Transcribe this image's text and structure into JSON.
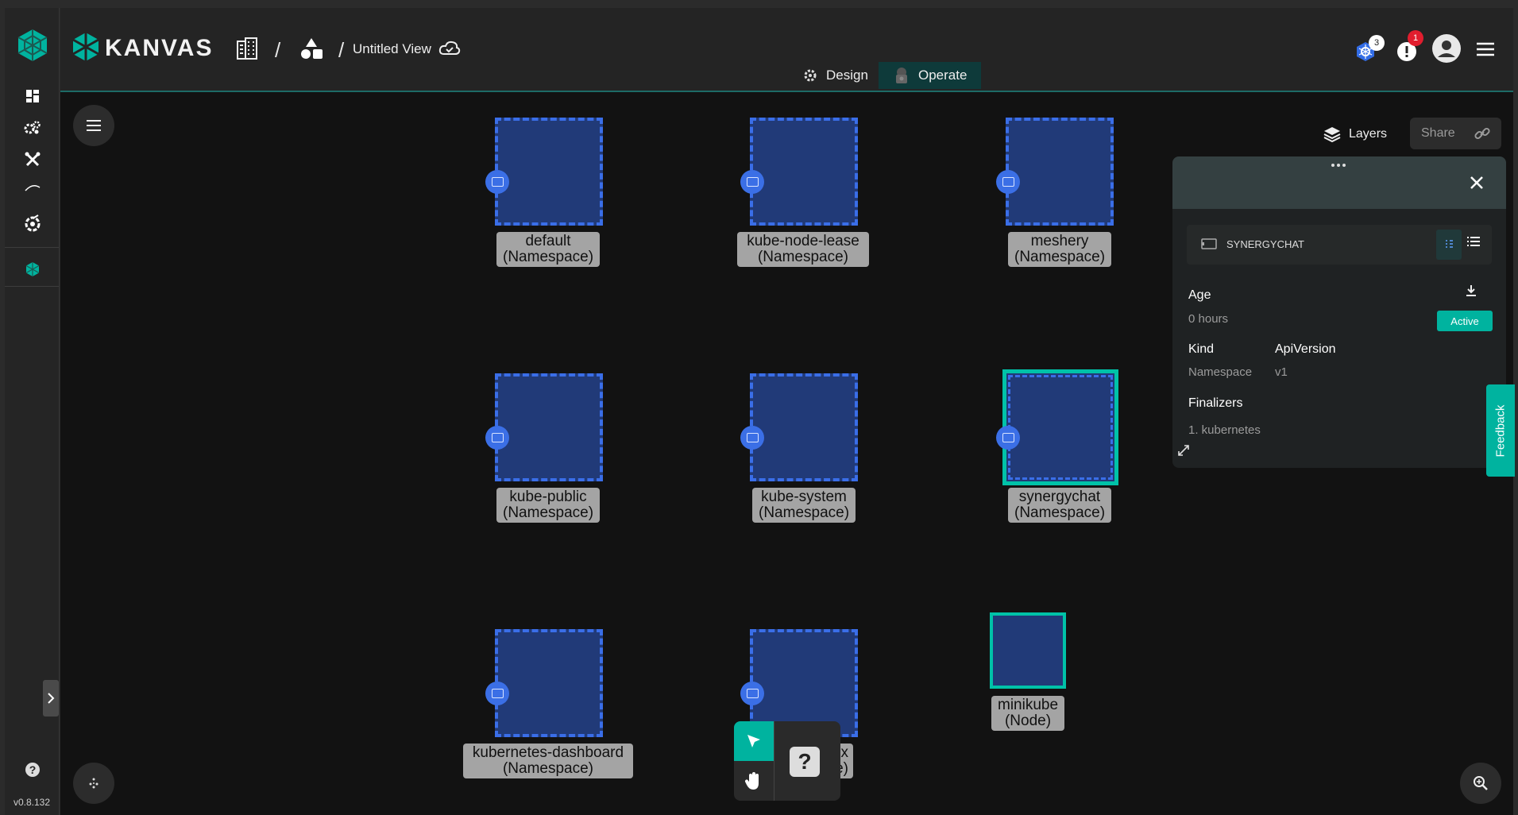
{
  "app": {
    "brand": "KANVAS",
    "view_title": "Untitled View",
    "version": "v0.8.132"
  },
  "header": {
    "modes": [
      {
        "label": "Design",
        "active": false
      },
      {
        "label": "Operate",
        "active": true
      }
    ],
    "kube_badge_count": "3",
    "notification_count": "1"
  },
  "toolbar": {
    "layers_label": "Layers",
    "share_label": "Share"
  },
  "nodes": [
    {
      "name": "default",
      "kind": "(Namespace)"
    },
    {
      "name": "kube-node-lease",
      "kind": "(Namespace)"
    },
    {
      "name": "meshery",
      "kind": "(Namespace)"
    },
    {
      "name": "kube-public",
      "kind": "(Namespace)"
    },
    {
      "name": "kube-system",
      "kind": "(Namespace)"
    },
    {
      "name": "synergychat",
      "kind": "(Namespace)"
    },
    {
      "name": "kubernetes-dashboard",
      "kind": "(Namespace)"
    },
    {
      "name": "nx",
      "kind": "e)"
    },
    {
      "name": "minikube",
      "kind": "(Node)"
    }
  ],
  "panel": {
    "resource_name": "SYNERGYCHAT",
    "age_label": "Age",
    "age_value": "0 hours",
    "status": "Active",
    "kind_label": "Kind",
    "kind_value": "Namespace",
    "api_label": "ApiVersion",
    "api_value": "v1",
    "finalizers_label": "Finalizers",
    "finalizers": [
      "1. kubernetes"
    ]
  },
  "feedback_label": "Feedback",
  "palette": {
    "help_symbol": "?"
  },
  "colors": {
    "accent": "#00b39f",
    "node_fill": "#213a78",
    "node_border": "#3a6ee8",
    "selected_border": "#00c2a8",
    "badge_red": "#e11d2e"
  }
}
